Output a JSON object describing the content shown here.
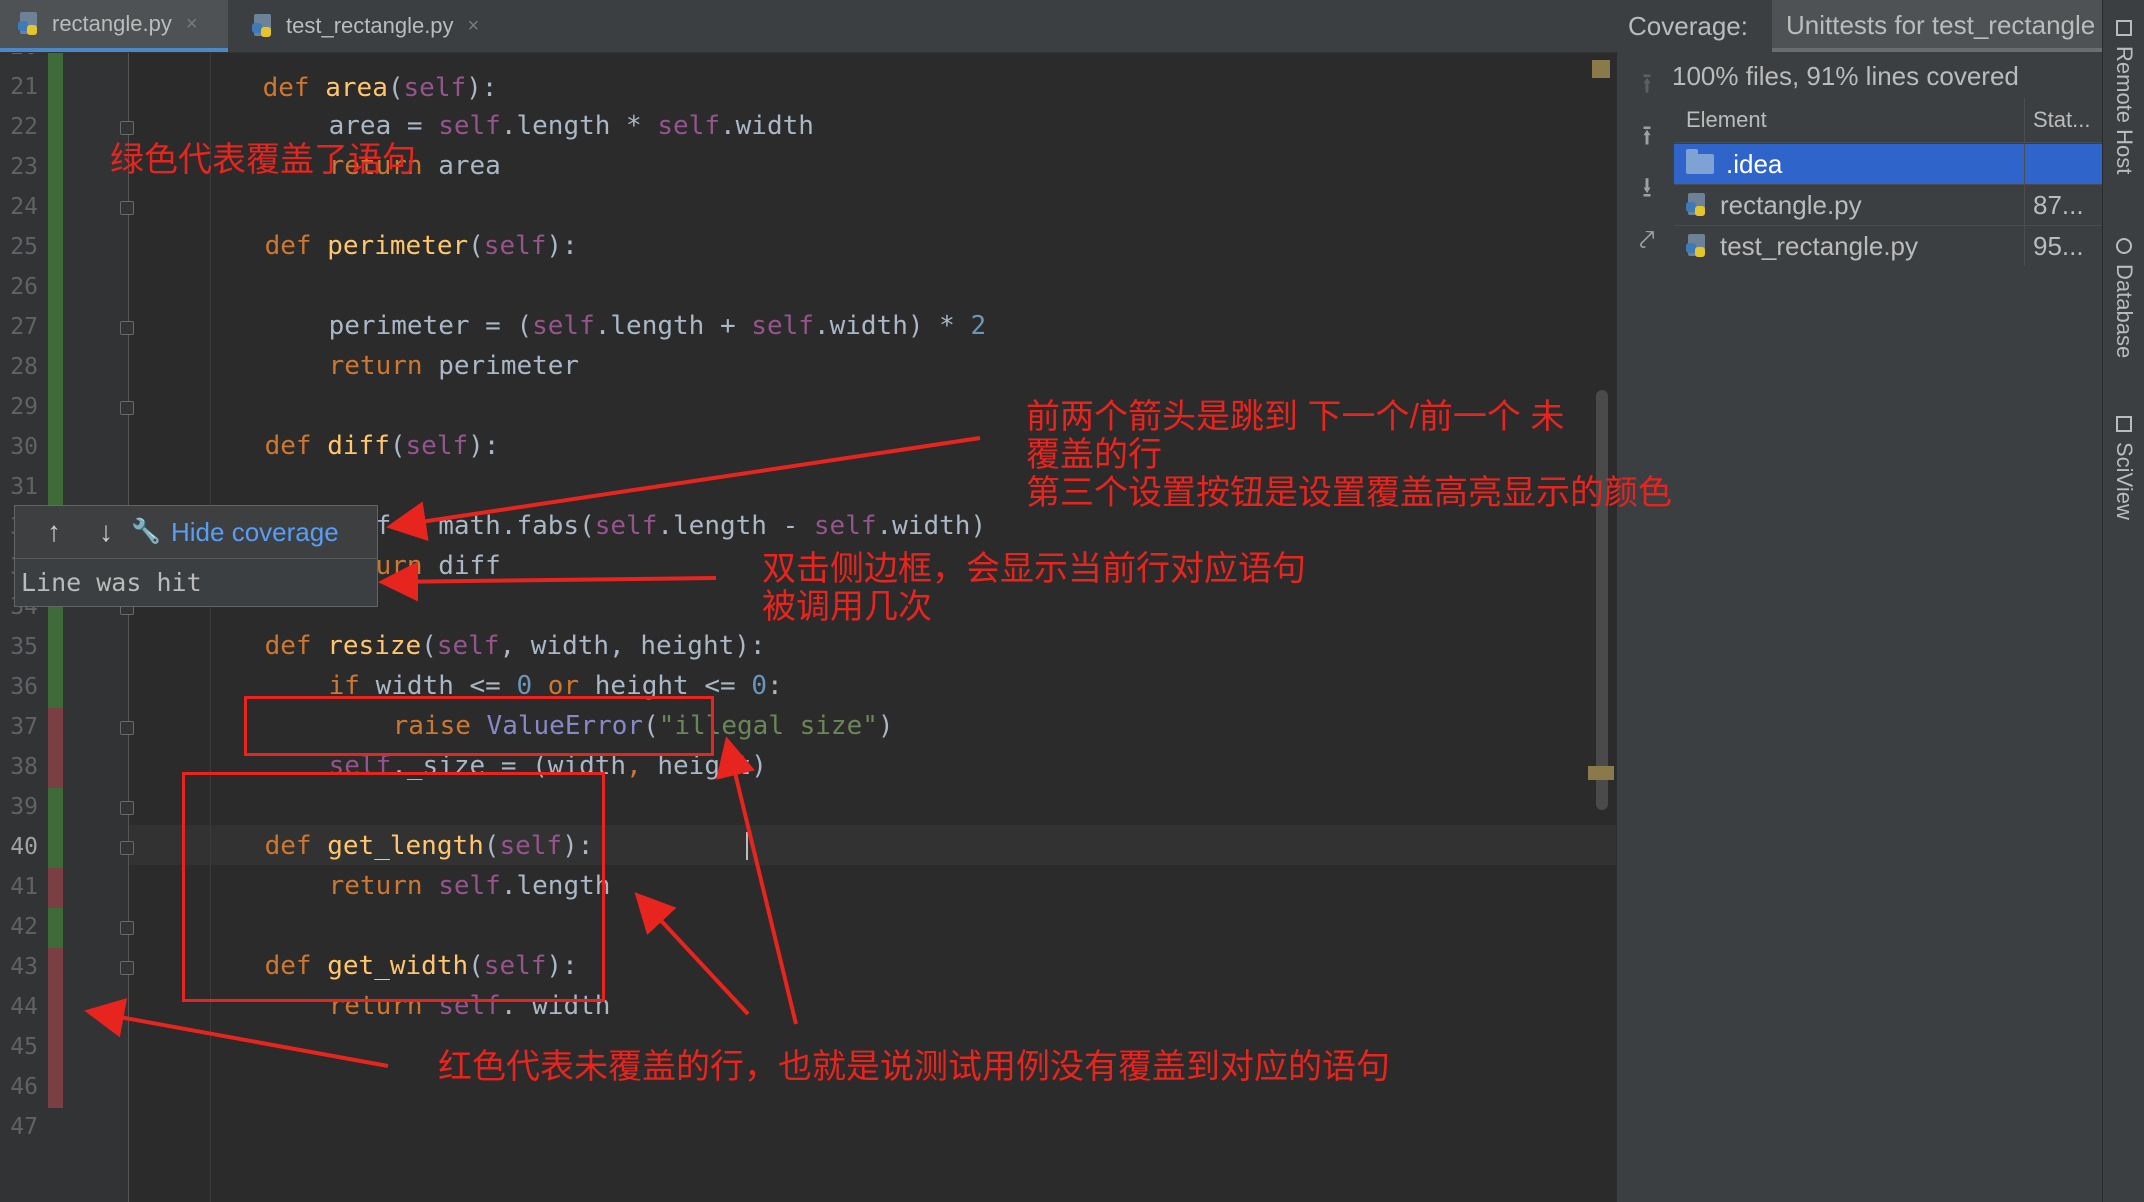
{
  "tabs": [
    {
      "label": "rectangle.py",
      "active": true
    },
    {
      "label": "test_rectangle.py",
      "active": false
    }
  ],
  "tab_close_glyph": "×",
  "editor": {
    "current_line": 40,
    "lines": [
      {
        "n": "20",
        "cov": "green"
      },
      {
        "n": "21",
        "cov": "green"
      },
      {
        "n": "22",
        "cov": "green"
      },
      {
        "n": "23",
        "cov": "green"
      },
      {
        "n": "24",
        "cov": "green"
      },
      {
        "n": "25",
        "cov": "green"
      },
      {
        "n": "26",
        "cov": "green"
      },
      {
        "n": "27",
        "cov": "green"
      },
      {
        "n": "28",
        "cov": "green"
      },
      {
        "n": "29",
        "cov": "green"
      },
      {
        "n": "30",
        "cov": "green"
      },
      {
        "n": "31",
        "cov": "green"
      },
      {
        "n": "32",
        "cov": "green"
      },
      {
        "n": "33",
        "cov": "green"
      },
      {
        "n": "34",
        "cov": "green"
      },
      {
        "n": "35",
        "cov": "green"
      },
      {
        "n": "36",
        "cov": "green"
      },
      {
        "n": "37",
        "cov": "red"
      },
      {
        "n": "38",
        "cov": "red"
      },
      {
        "n": "39",
        "cov": "green"
      },
      {
        "n": "40",
        "cov": "green"
      },
      {
        "n": "41",
        "cov": "red"
      },
      {
        "n": "42",
        "cov": "green"
      },
      {
        "n": "43",
        "cov": "red"
      },
      {
        "n": "44",
        "cov": "red"
      },
      {
        "n": "45",
        "cov": "red"
      },
      {
        "n": "46",
        "cov": "red"
      },
      {
        "n": "47",
        "cov": "none"
      }
    ],
    "code": {
      "l20": [
        "def ",
        "area",
        "(",
        "self",
        "):"
      ],
      "l21": [
        "area = ",
        "self",
        ".length * ",
        "self",
        ".width"
      ],
      "l22": [
        "return ",
        "area"
      ],
      "l24": [
        "def ",
        "perimeter",
        "(",
        "self",
        "):"
      ],
      "l26": [
        "perimeter = (",
        "self",
        ".length + ",
        "self",
        ".width) * ",
        "2"
      ],
      "l27": [
        "return ",
        "perimeter"
      ],
      "l29": [
        "def ",
        "diff",
        "(",
        "self",
        "):"
      ],
      "l31": [
        "diff = math.fabs(",
        "self",
        ".length - ",
        "self",
        ".width)"
      ],
      "l32": [
        "return ",
        "diff"
      ],
      "l34": [
        "def ",
        "resize",
        "(",
        "self",
        ", width, height):"
      ],
      "l35": [
        "if ",
        "width <= ",
        "0",
        " or ",
        "height <= ",
        "0",
        ":"
      ],
      "l36": [
        "raise ",
        "ValueError",
        "(",
        "\"illegal size\"",
        ")"
      ],
      "l37": [
        "self",
        "._size = (width",
        ", ",
        "height)"
      ],
      "l39": [
        "def ",
        "get_length",
        "(",
        "self",
        "):"
      ],
      "l40": [
        "return ",
        "self",
        ".length"
      ],
      "l42": [
        "def ",
        "get_width",
        "(",
        "self",
        "):"
      ],
      "l43": [
        "return ",
        "self",
        ". width"
      ]
    }
  },
  "popup": {
    "hide_label": "Hide coverage",
    "message": "Line was hit",
    "up_glyph": "↑",
    "down_glyph": "↓",
    "wrench_glyph": "🔧"
  },
  "coverage": {
    "label": "Coverage:",
    "tab": "Unittests for test_rectangle",
    "summary": "100% files, 91% lines covered",
    "columns": [
      "Element",
      "Stat..."
    ],
    "rows": [
      {
        "name": ".idea",
        "stat": "",
        "icon": "folder-icon",
        "selected": true
      },
      {
        "name": "rectangle.py",
        "stat": "87...",
        "icon": "python-file-icon",
        "selected": false
      },
      {
        "name": "test_rectangle.py",
        "stat": "95...",
        "icon": "python-file-icon",
        "selected": false
      }
    ],
    "tool_glyphs": [
      "⭱",
      "⭱",
      "⭳",
      "⤤"
    ]
  },
  "side_tabs": [
    "Remote Host",
    "Database",
    "SciView"
  ],
  "annotations": {
    "green_meaning": "绿色代表覆盖了语句",
    "arrows_line1": "前两个箭头是跳到 下一个/前一个 未",
    "arrows_line2": "覆盖的行",
    "arrows_line3": "第三个设置按钮是设置覆盖高亮显示的颜色",
    "dblclick_line1": "双击侧边框，会显示当前行对应语句",
    "dblclick_line2": "被调用几次",
    "red_meaning": "红色代表未覆盖的行，也就是说测试用例没有覆盖到对应的语句"
  },
  "colors": {
    "covered": "#3f6b3a",
    "uncovered": "#7a3f43",
    "annotation": "#e8241f",
    "selection": "#2f65ca",
    "link": "#589df6"
  }
}
